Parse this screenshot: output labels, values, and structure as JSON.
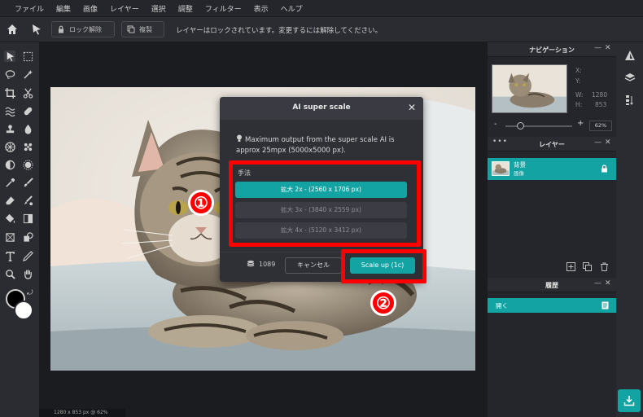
{
  "menu": [
    "ファイル",
    "編集",
    "画像",
    "レイヤー",
    "選択",
    "調整",
    "フィルター",
    "表示",
    "ヘルプ"
  ],
  "toolbar": {
    "unlock_label": "ロック解除",
    "duplicate_label": "複製",
    "message": "レイヤーはロックされています。変更するには解除してください。"
  },
  "status": {
    "canvas_info": "1280 x 853 px @ 62%"
  },
  "dialog": {
    "title": "AI super scale",
    "info": "Maximum output from the super scale AI is approx 25mpx (5000x5000 px).",
    "method_label": "手法",
    "options": [
      {
        "label": "拡大 2x - (2560 x 1706 px)",
        "state": "selected"
      },
      {
        "label": "拡大 3x - (3840 x 2559 px)",
        "state": "disabled"
      },
      {
        "label": "拡大 4x - (5120 x 3412 px)",
        "state": "disabled"
      }
    ],
    "credits": "1089",
    "cancel_label": "キャンセル",
    "scale_label": "Scale up (1c)"
  },
  "annotations": {
    "num1": "①",
    "num2": "②",
    "color": "#ff0000"
  },
  "navigation": {
    "title": "ナビゲーション",
    "x_label": "X:",
    "y_label": "Y:",
    "w_label": "W:",
    "h_label": "H:",
    "w_value": "1280",
    "h_value": "853",
    "zoom": "62%",
    "minus": "-",
    "plus": "+"
  },
  "layers": {
    "title": "レイヤー",
    "items": [
      {
        "name": "背景",
        "type": "画像"
      }
    ]
  },
  "history": {
    "title": "履歴",
    "items": [
      {
        "name": "開く"
      }
    ]
  },
  "colors": {
    "accent": "#13a3a3",
    "foreground": "#000000",
    "background": "#ffffff"
  }
}
